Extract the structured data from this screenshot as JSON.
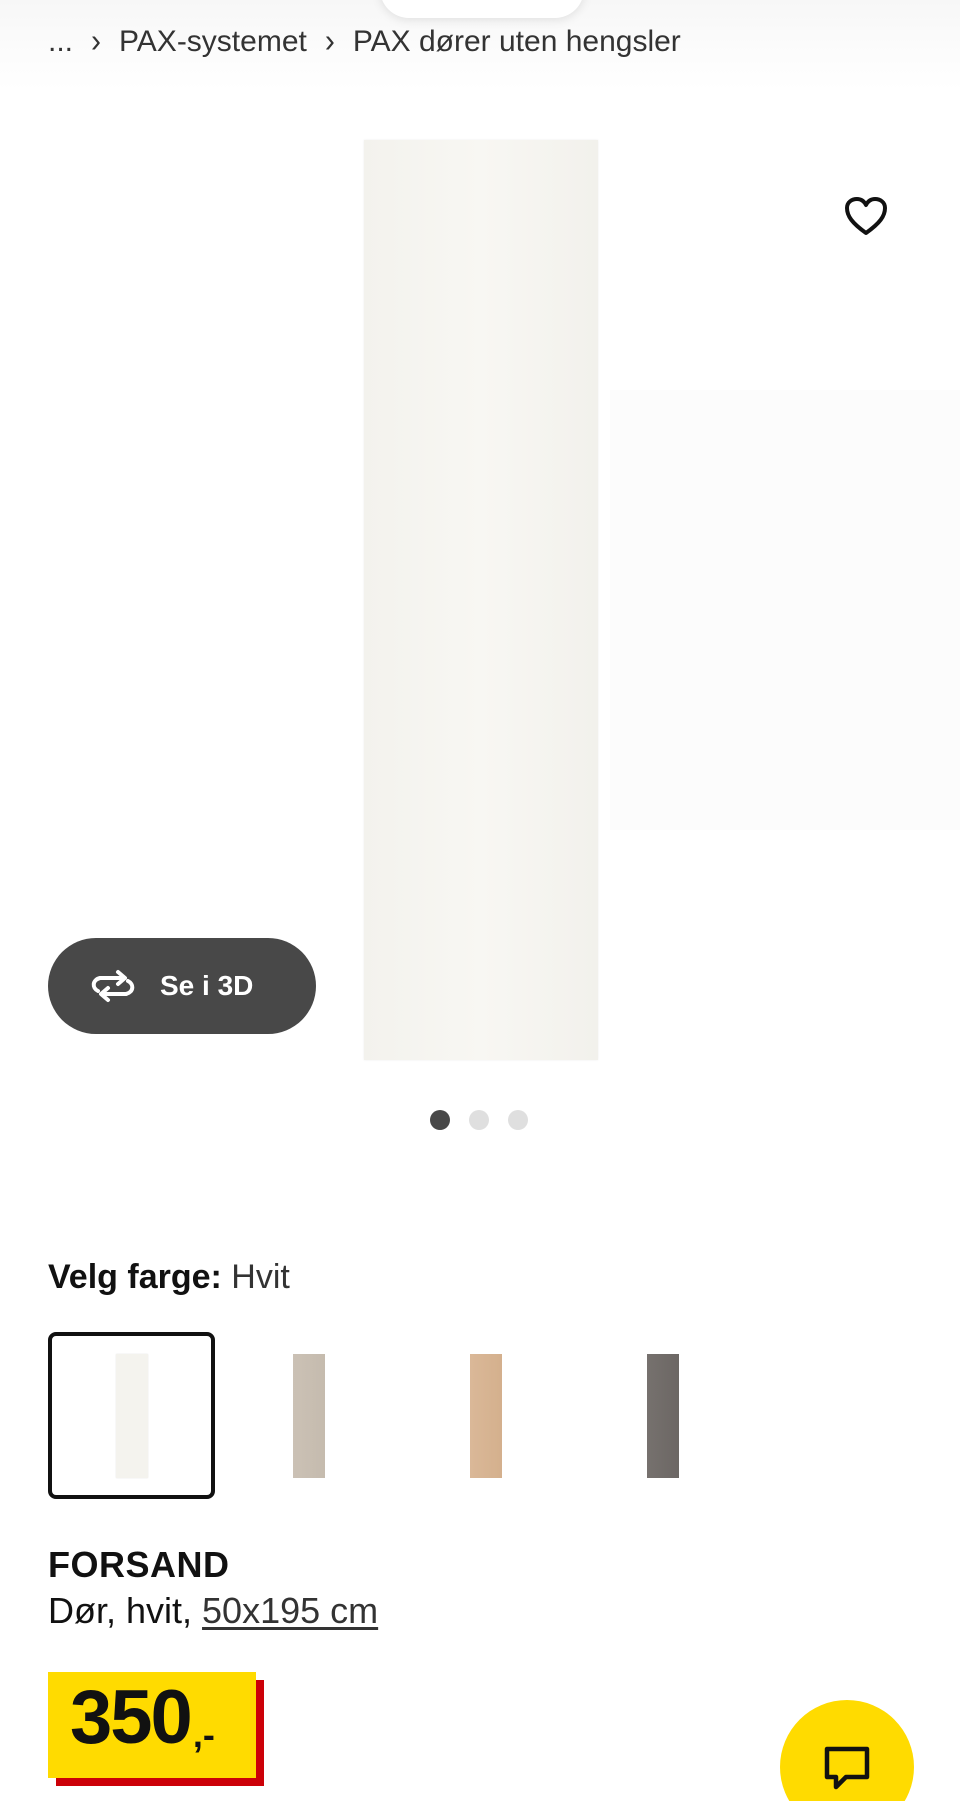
{
  "breadcrumb": {
    "ellipsis": "...",
    "sep": "›",
    "items": [
      "PAX-systemet",
      "PAX dører uten hengsler"
    ]
  },
  "gallery": {
    "view_3d_label": "Se i 3D",
    "dots_count": 3,
    "active_dot": 1
  },
  "color_selector": {
    "label": "Velg farge:",
    "selected": "Hvit",
    "swatches": [
      {
        "name": "white",
        "color": "#f4f3ee",
        "selected": true
      },
      {
        "name": "beige-grey",
        "color": "#c9bfb3",
        "selected": false
      },
      {
        "name": "oak",
        "color": "#d8b593",
        "selected": false
      },
      {
        "name": "dark-grey",
        "color": "#716c69",
        "selected": false
      }
    ]
  },
  "product": {
    "name": "FORSAND",
    "desc_prefix": "Dør, hvit, ",
    "size": "50x195 cm"
  },
  "price": {
    "integer": "350",
    "suffix": ",-"
  },
  "colors": {
    "price_yellow": "#ffdb00",
    "price_red": "#cc0008",
    "button_dark": "#484848"
  }
}
